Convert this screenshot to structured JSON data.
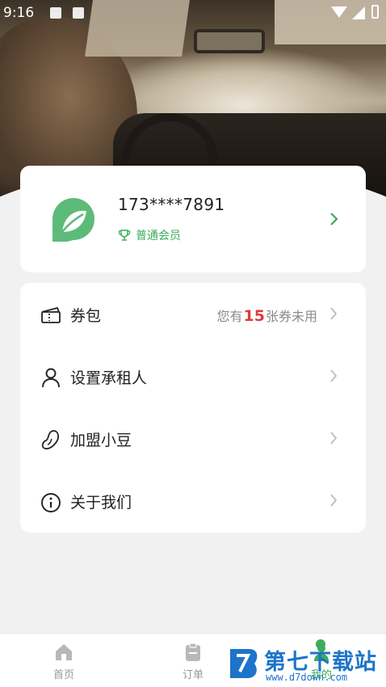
{
  "status_bar": {
    "time": "9:16"
  },
  "profile": {
    "phone": "173****7891",
    "membership": "普通会员"
  },
  "menu": {
    "coupon": {
      "label": "券包",
      "prefix": "您有",
      "count": "15",
      "suffix": "张券未用"
    },
    "renter": {
      "label": "设置承租人"
    },
    "join": {
      "label": "加盟小豆"
    },
    "about": {
      "label": "关于我们"
    }
  },
  "tabs": [
    {
      "label": "首页",
      "icon": "home-icon"
    },
    {
      "label": "订单",
      "icon": "order-icon"
    },
    {
      "label": "我的",
      "icon": "profile-icon"
    }
  ],
  "watermark": {
    "title": "第七下载站",
    "url": "www.d7down.com"
  },
  "colors": {
    "accent": "#3dab5a",
    "highlight": "#e03b3b",
    "watermark": "#1d74c9"
  }
}
